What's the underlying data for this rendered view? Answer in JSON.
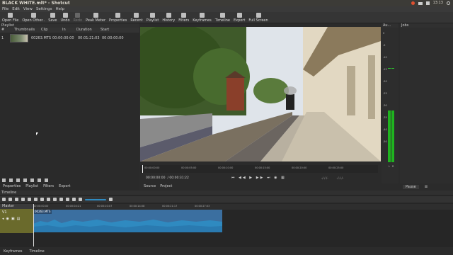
{
  "window": {
    "title": "BLACK WHITE.mlt* - Shotcut",
    "clock": "13:13"
  },
  "menu": [
    "File",
    "Edit",
    "View",
    "Settings",
    "Help"
  ],
  "toolbar": [
    {
      "label": "Open File",
      "icon": "folder-icon",
      "enabled": true
    },
    {
      "label": "Open Other..",
      "icon": "open-other-icon",
      "enabled": true
    },
    {
      "label": "Save",
      "icon": "save-icon",
      "enabled": true
    },
    {
      "label": "Undo",
      "icon": "undo-icon",
      "enabled": true
    },
    {
      "label": "Redo",
      "icon": "redo-icon",
      "enabled": false
    },
    {
      "label": "Peak Meter",
      "icon": "meter-icon",
      "enabled": true
    },
    {
      "label": "Properties",
      "icon": "properties-icon",
      "enabled": true
    },
    {
      "label": "Recent",
      "icon": "recent-icon",
      "enabled": true
    },
    {
      "label": "Playlist",
      "icon": "playlist-icon",
      "enabled": true
    },
    {
      "label": "History",
      "icon": "history-icon",
      "enabled": true
    },
    {
      "label": "Filters",
      "icon": "filters-icon",
      "enabled": true
    },
    {
      "label": "Keyframes",
      "icon": "keyframes-icon",
      "enabled": true
    },
    {
      "label": "Timeline",
      "icon": "timeline-icon",
      "enabled": true
    },
    {
      "label": "Export",
      "icon": "export-icon",
      "enabled": true
    },
    {
      "label": "Full Screen",
      "icon": "fullscreen-icon",
      "enabled": true
    }
  ],
  "playlist": {
    "title": "Playlist",
    "columns": [
      "#",
      "Thumbnails",
      "Clip",
      "In",
      "Duration",
      "Start"
    ],
    "rows": [
      {
        "num": "1",
        "clip": "00263.MTS",
        "in": "00:00:00:00",
        "duration": "00:01:21:03",
        "start": "00:00:00:00"
      }
    ],
    "tabs": [
      "Properties",
      "Playlist",
      "Filters",
      "Export"
    ]
  },
  "player": {
    "timecode": "00:00:00:00",
    "duration": "/ 00:00:31:22",
    "ruler": [
      "00:00:00:00",
      "00:00:05:00",
      "00:00:10:00",
      "00:00:15:00",
      "00:00:20:00",
      "00:00:25:00"
    ],
    "tabs": [
      "Source",
      "Project"
    ],
    "vol_left": "-/-/-/-",
    "vol_right": "-/-/-/-"
  },
  "audio": {
    "title": "Au...",
    "marks": [
      "0",
      "-5",
      "-10",
      "-15",
      "-20",
      "-25",
      "-30",
      "-35",
      "-40",
      "-50"
    ],
    "channels": [
      "L",
      "R"
    ],
    "level_fraction": 0.52
  },
  "jobs": {
    "title": "Jobs",
    "pause": "Pause"
  },
  "timeline": {
    "title": "Timeline",
    "master": "Master",
    "track": "V1",
    "ruler": [
      "00:00:00:00",
      "00:00:04:21",
      "00:00:10:07",
      "00:00:14:08",
      "00:00:21:17",
      "00:00:27:03"
    ],
    "clip": "00263.MTS"
  },
  "bottom_tabs": [
    "Keyframes",
    "Timeline"
  ],
  "colors": {
    "clip": "#3b6fa0",
    "track": "#6a6a2c",
    "meter": "#1fb31f"
  }
}
